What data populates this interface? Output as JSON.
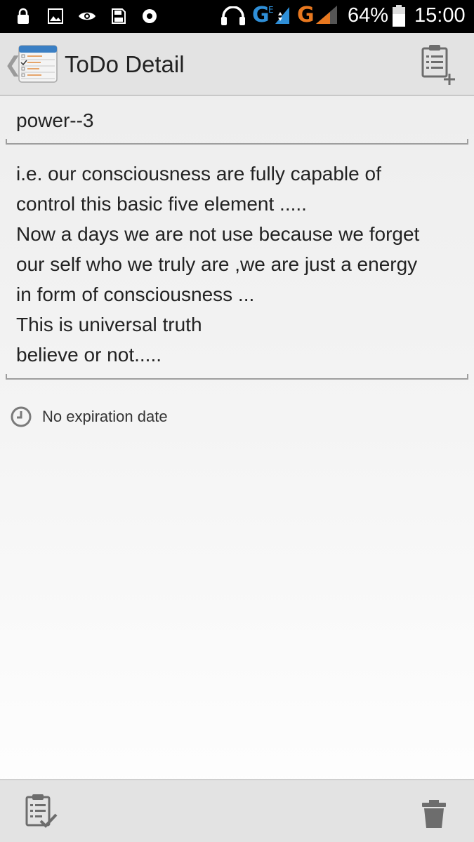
{
  "status_bar": {
    "network_1": "G",
    "network_2": "G",
    "battery_percent": "64%",
    "time": "15:00",
    "icons": [
      "lock-icon",
      "image-icon",
      "eye-icon",
      "sd-card-icon",
      "media-icon",
      "headphones-icon",
      "signal-icon",
      "battery-icon"
    ]
  },
  "action_bar": {
    "title": "ToDo Detail",
    "icons": [
      "back-chevron-icon",
      "app-todo-icon",
      "add-todo-icon"
    ]
  },
  "todo": {
    "title": "power--3",
    "notes_lines": [
      "i.e. our consciousness are fully capable of",
      "control this basic five element .....",
      "Now a days we are not use because we forget",
      "our self who we truly are ,we are just a energy",
      "in form of consciousness ...",
      "This is universal truth",
      "believe or not....."
    ],
    "expiration_label": "No expiration date"
  },
  "bottom_bar": {
    "icons": [
      "checklist-icon",
      "trash-icon"
    ]
  },
  "colors": {
    "network_blue": "#2f8fd8",
    "network_orange": "#e8781f",
    "bar_bg": "#e3e3e3",
    "divider": "#9e9e9e"
  }
}
